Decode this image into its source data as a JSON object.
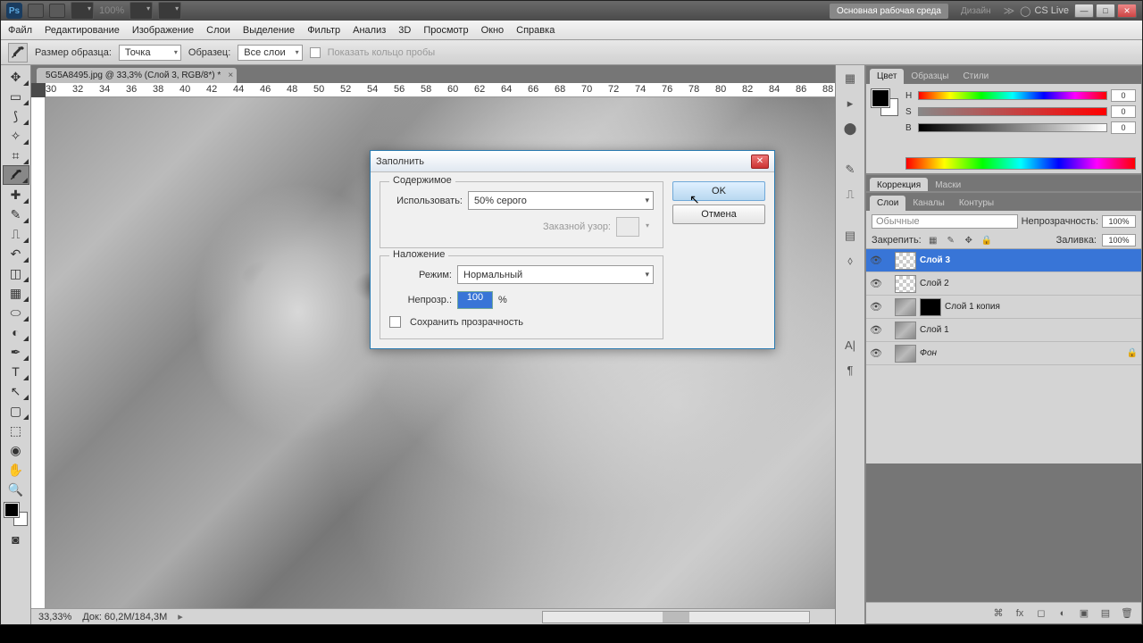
{
  "titlebar": {
    "zoom": "100%",
    "workspace_main": "Основная рабочая среда",
    "workspace_design": "Дизайн",
    "cslive": "CS Live"
  },
  "menu": [
    "Файл",
    "Редактирование",
    "Изображение",
    "Слои",
    "Выделение",
    "Фильтр",
    "Анализ",
    "3D",
    "Просмотр",
    "Окно",
    "Справка"
  ],
  "options": {
    "sample_size_label": "Размер образца:",
    "sample_size_value": "Точка",
    "sample_label": "Образец:",
    "sample_value": "Все слои",
    "show_ring": "Показать кольцо пробы"
  },
  "doc_tab": "5G5A8495.jpg @ 33,3% (Слой 3, RGB/8*) *",
  "ruler_ticks": [
    "30",
    "32",
    "34",
    "36",
    "38",
    "40",
    "42",
    "44",
    "46",
    "48",
    "50",
    "52",
    "54",
    "56",
    "58",
    "60",
    "62",
    "64",
    "66",
    "68",
    "70",
    "72",
    "74",
    "76",
    "78",
    "80",
    "82",
    "84",
    "86",
    "88"
  ],
  "status": {
    "zoom": "33,33%",
    "doc": "Док: 60,2M/184,3M"
  },
  "color_panel": {
    "tabs": [
      "Цвет",
      "Образцы",
      "Стили"
    ],
    "h_label": "H",
    "s_label": "S",
    "b_label": "B",
    "h": "0",
    "s": "0",
    "b": "0"
  },
  "adj_panel": {
    "tabs": [
      "Коррекция",
      "Маски"
    ]
  },
  "layers_panel": {
    "tabs": [
      "Слои",
      "Каналы",
      "Контуры"
    ],
    "blend_mode": "Обычные",
    "opacity_label": "Непрозрачность:",
    "opacity": "100%",
    "lock_label": "Закрепить:",
    "fill_label": "Заливка:",
    "fill": "100%",
    "layers": [
      {
        "name": "Слой 3",
        "selected": true,
        "thumb": "checker"
      },
      {
        "name": "Слой 2",
        "thumb": "checker"
      },
      {
        "name": "Слой 1 копия",
        "thumb": "img",
        "mask": true
      },
      {
        "name": "Слой 1",
        "thumb": "img"
      },
      {
        "name": "Фон",
        "thumb": "img",
        "locked": true,
        "italic": true
      }
    ]
  },
  "dialog": {
    "title": "Заполнить",
    "content_legend": "Содержимое",
    "use_label": "Использовать:",
    "use_value": "50% серого",
    "pattern_label": "Заказной узор:",
    "blend_legend": "Наложение",
    "mode_label": "Режим:",
    "mode_value": "Нормальный",
    "opacity_label": "Непрозр.:",
    "opacity_value": "100",
    "percent": "%",
    "preserve": "Сохранить прозрачность",
    "ok": "OK",
    "cancel": "Отмена"
  }
}
